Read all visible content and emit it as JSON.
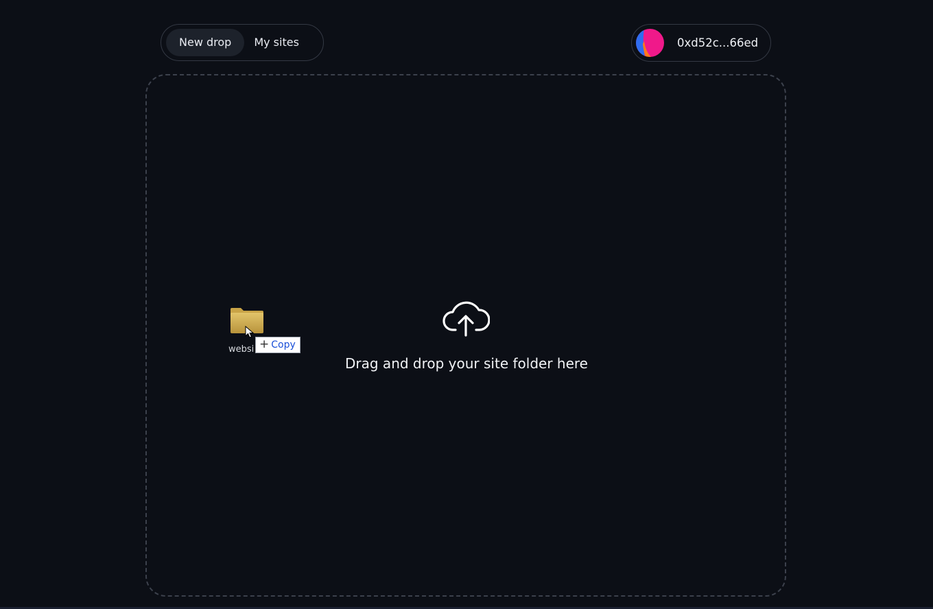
{
  "nav": {
    "tabs": [
      {
        "label": "New drop",
        "active": true
      },
      {
        "label": "My sites",
        "active": false
      }
    ]
  },
  "wallet": {
    "address": "0xd52c...66ed",
    "avatar_colors": [
      "#2f6df0",
      "#f0198a",
      "#ff7a1a"
    ]
  },
  "dropzone": {
    "icon": "cloud-upload-icon",
    "message": "Drag and drop your site folder here"
  },
  "drag_overlay": {
    "icon": "folder-icon",
    "label": "websi",
    "action_label": "Copy"
  },
  "colors": {
    "background": "#0c0f16",
    "border": "#343944",
    "active_tab": "#1d222b",
    "folder": "#d4b45a",
    "copy_text": "#1a4fd8"
  }
}
